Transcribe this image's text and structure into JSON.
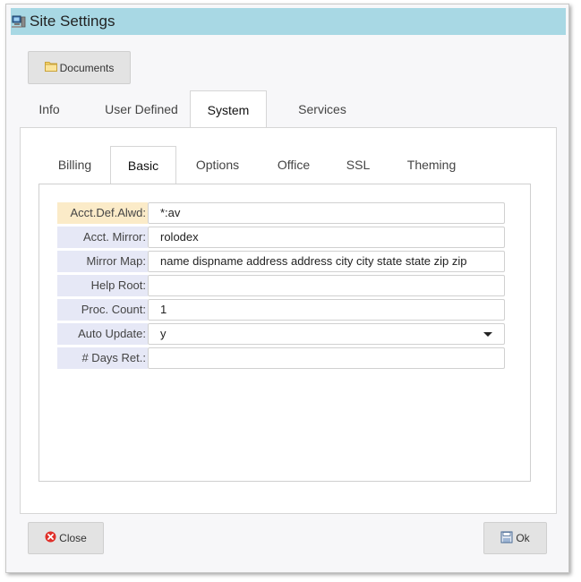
{
  "window": {
    "title": "Site Settings"
  },
  "toolbar": {
    "documents_label": "Documents"
  },
  "tabs": [
    {
      "label": "Info"
    },
    {
      "label": "User Defined"
    },
    {
      "label": "System",
      "active": true
    },
    {
      "label": "Services"
    }
  ],
  "subtabs": [
    {
      "label": "Billing"
    },
    {
      "label": "Basic",
      "active": true
    },
    {
      "label": "Options"
    },
    {
      "label": "Office"
    },
    {
      "label": "SSL"
    },
    {
      "label": "Theming"
    }
  ],
  "fields": [
    {
      "label": "Acct.Def.Alwd:",
      "value": "*:av"
    },
    {
      "label": "Acct. Mirror:",
      "value": "rolodex"
    },
    {
      "label": "Mirror Map:",
      "value": "name dispname address address city city state state zip zip"
    },
    {
      "label": "Help Root:",
      "value": ""
    },
    {
      "label": "Proc. Count:",
      "value": "1"
    },
    {
      "label": "Auto Update:",
      "value": "y"
    },
    {
      "label": "# Days Ret.:",
      "value": ""
    }
  ],
  "footer": {
    "close_label": "Close",
    "ok_label": "Ok"
  },
  "colors": {
    "titlebar": "#a8d8e4",
    "label_bg": "#e6e8f6",
    "label_highlight": "#fbebc8",
    "close_icon": "#e0302a"
  }
}
